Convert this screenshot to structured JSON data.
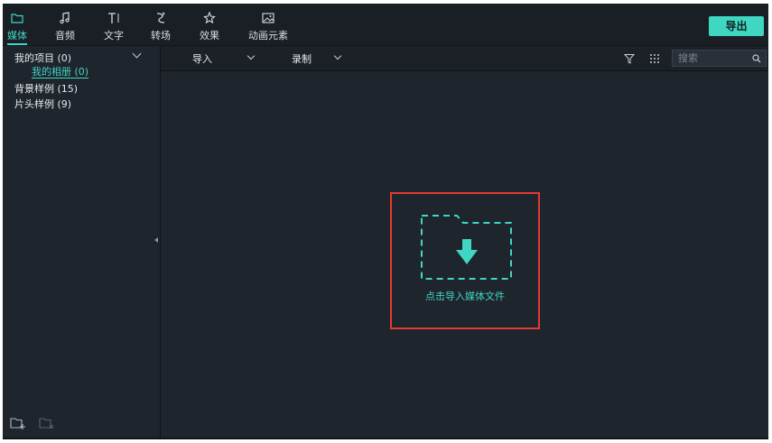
{
  "toolbar": {
    "tabs": [
      {
        "label": "媒体",
        "icon": "folder-icon",
        "active": true
      },
      {
        "label": "音频",
        "icon": "music-note-icon",
        "active": false
      },
      {
        "label": "文字",
        "icon": "text-icon",
        "active": false
      },
      {
        "label": "转场",
        "icon": "transition-icon",
        "active": false
      },
      {
        "label": "效果",
        "icon": "effects-icon",
        "active": false
      },
      {
        "label": "动画元素",
        "icon": "image-icon",
        "active": false
      }
    ],
    "export_label": "导出"
  },
  "sidebar": {
    "items": [
      {
        "label": "我的项目 (0)"
      },
      {
        "label": "我的相册 (0)"
      },
      {
        "label": "背景样例 (15)"
      },
      {
        "label": "片头样例 (9)"
      }
    ],
    "bottom_icons": [
      "new-folder-icon",
      "delete-folder-icon"
    ]
  },
  "main": {
    "subbar": {
      "import_label": "导入",
      "record_label": "录制",
      "search_placeholder": "搜索"
    },
    "drop_zone": {
      "text": "点击导入媒体文件"
    }
  },
  "colors": {
    "accent": "#3fd6c2",
    "background": "#1f252d",
    "highlight_border": "#e23a32"
  }
}
